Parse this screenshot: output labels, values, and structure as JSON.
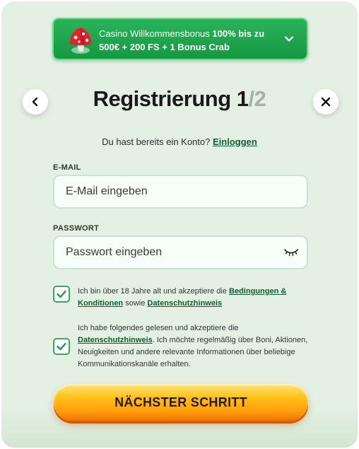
{
  "bonus": {
    "text_prefix": "Casino Willkommensbonus ",
    "text_bold": "100% bis zu 500€ + 200 FS + 1 Bonus Crab"
  },
  "header": {
    "title_main": "Registrierung 1",
    "title_sep": "/",
    "title_total": "2"
  },
  "login": {
    "question": "Du hast bereits ein Konto? ",
    "link": "Einloggen"
  },
  "form": {
    "email_label": "E-MAIL",
    "email_placeholder": "E-Mail eingeben",
    "password_label": "PASSWORT",
    "password_placeholder": "Passwort eingeben"
  },
  "consents": {
    "age_text": "Ich bin über 18 Jahre alt und akzeptiere die ",
    "age_link_terms": "Bedingungen & Konditionen",
    "age_mid": " sowie ",
    "age_link_privacy": "Datenschutzhinweis",
    "marketing_text": "Ich habe folgendes gelesen und akzeptiere die ",
    "marketing_link": "Datenschutzhinweis",
    "marketing_rest": ". Ich möchte regelmäßig über Boni, Aktionen, Neuigkeiten und andere relevante Informationen über beliebige Kommunikationskanäle erhalten.",
    "age_checked": true,
    "marketing_checked": true
  },
  "next_button": "NÄCHSTER SCHRITT",
  "colors": {
    "background": "#e4f0e3",
    "banner_green": "#1fa44e",
    "link_green": "#0d5d33",
    "button_orange": "#ffb400"
  },
  "icons": {
    "bonus": "red-mushroom-icon",
    "chevron": "chevron-down-icon",
    "back": "chevron-left-icon",
    "close": "close-icon",
    "eye": "eye-closed-icon",
    "check": "checkmark-icon"
  }
}
